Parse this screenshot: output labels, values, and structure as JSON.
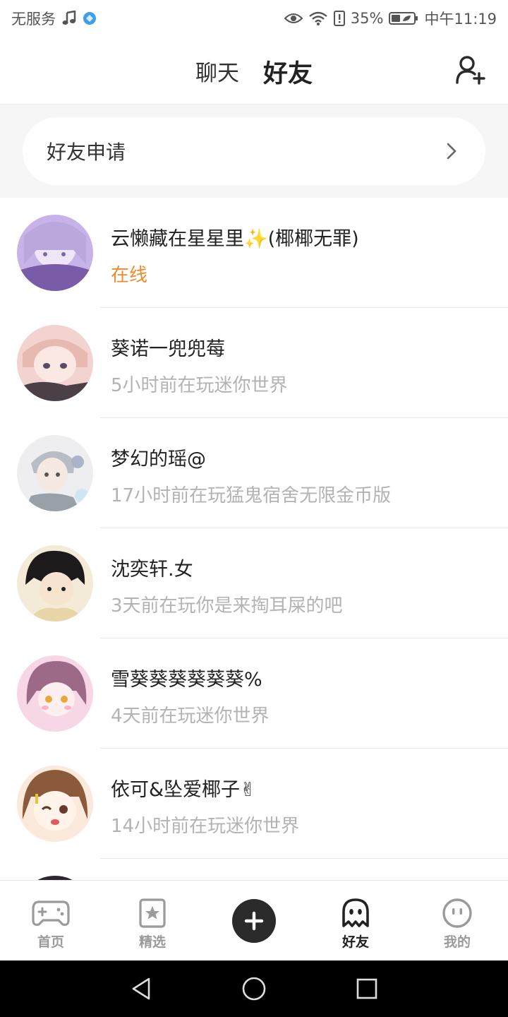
{
  "status_bar": {
    "carrier": "无服务",
    "battery_percent": "35%",
    "time": "中午11:19",
    "icons": [
      "music-note-icon",
      "browser-icon",
      "eye-icon",
      "wifi-icon",
      "battery-saver-icon",
      "battery-icon"
    ]
  },
  "header": {
    "tabs": [
      {
        "label": "聊天",
        "active": false
      },
      {
        "label": "好友",
        "active": true
      }
    ],
    "add_friend_icon": "add-user-icon",
    "accent_color": "#f26a21"
  },
  "friend_request": {
    "label": "好友申请",
    "chevron_icon": "chevron-right-icon"
  },
  "friends": [
    {
      "name": "云懒藏在星星里✨(椰椰无罪)",
      "status": "在线",
      "online": true,
      "avatar_colors": [
        "#c7b3e8",
        "#7a5ba8"
      ]
    },
    {
      "name": "葵诺一兜兜莓",
      "status": "5小时前在玩迷你世界",
      "online": false,
      "avatar_colors": [
        "#f2d3cf",
        "#5a4a52"
      ]
    },
    {
      "name": "梦幻的瑶@",
      "status": "17小时前在玩猛鬼宿舍无限金币版",
      "online": false,
      "avatar_colors": [
        "#e6e6e8",
        "#9aa0a8"
      ]
    },
    {
      "name": "沈奕轩.女",
      "status": "3天前在玩你是来掏耳屎的吧",
      "online": false,
      "avatar_colors": [
        "#f3ead8",
        "#1e1a1c"
      ]
    },
    {
      "name": "雪葵葵葵葵葵葵%",
      "status": "4天前在玩迷你世界",
      "online": false,
      "avatar_colors": [
        "#f7d6e6",
        "#9c6a86"
      ]
    },
    {
      "name": "依可&坠爱椰子✌",
      "status": "14小时前在玩迷你世界",
      "online": false,
      "avatar_colors": [
        "#fbe9dc",
        "#8a5a3a"
      ]
    }
  ],
  "bottom_nav": [
    {
      "label": "首页",
      "icon": "gamepad-icon",
      "active": false
    },
    {
      "label": "精选",
      "icon": "star-bookmark-icon",
      "active": false
    },
    {
      "label": "",
      "icon": "plus-icon",
      "active": false
    },
    {
      "label": "好友",
      "icon": "ghost-icon",
      "active": true
    },
    {
      "label": "我的",
      "icon": "face-icon",
      "active": false
    }
  ],
  "system_nav": {
    "icons": [
      "back-triangle-icon",
      "home-circle-icon",
      "recents-square-icon"
    ]
  }
}
